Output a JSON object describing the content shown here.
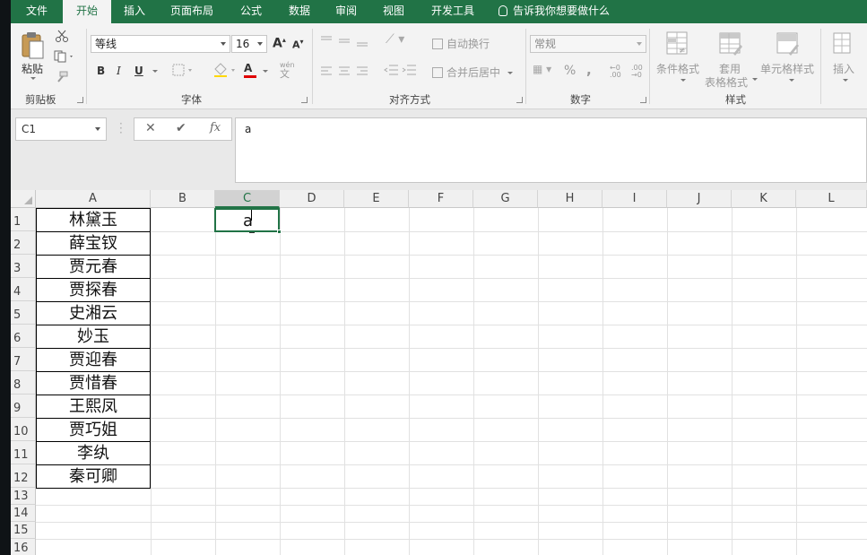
{
  "menu": {
    "tabs": [
      "文件",
      "开始",
      "插入",
      "页面布局",
      "公式",
      "数据",
      "审阅",
      "视图",
      "开发工具"
    ],
    "active_tab": "开始",
    "tell_me": "告诉我你想要做什么"
  },
  "ribbon": {
    "clipboard": {
      "paste": "粘贴",
      "label": "剪贴板"
    },
    "font": {
      "name": "等线",
      "size": "16",
      "bold": "B",
      "italic": "I",
      "underline": "U",
      "label": "字体",
      "grow": "A",
      "shrink": "A",
      "phonetic_top": "wén",
      "phonetic_bottom": "文",
      "font_color": "A"
    },
    "alignment": {
      "wrap": "自动换行",
      "merge": "合并后居中",
      "label": "对齐方式"
    },
    "number": {
      "format": "常规",
      "percent": "%",
      "comma": ",",
      "label": "数字",
      "inc_decimal": "←0 .00",
      "dec_decimal": ".00 →0"
    },
    "styles": {
      "conditional": "条件格式",
      "table_top": "套用",
      "table_bottom": "表格格式",
      "cell_styles": "单元格样式",
      "label": "样式"
    },
    "cells": {
      "insert": "插入"
    }
  },
  "formula_bar": {
    "name_box": "C1",
    "cancel": "✕",
    "enter": "✔",
    "fx": "fx",
    "content": "a"
  },
  "sheet": {
    "columns": [
      "A",
      "B",
      "C",
      "D",
      "E",
      "F",
      "G",
      "H",
      "I",
      "J",
      "K",
      "L"
    ],
    "selected_column": "C",
    "rows": [
      "1",
      "2",
      "3",
      "4",
      "5",
      "6",
      "7",
      "8",
      "9",
      "10",
      "11",
      "12",
      "13",
      "14",
      "15",
      "16"
    ],
    "column_a": [
      "林黛玉",
      "薛宝钗",
      "贾元春",
      "贾探春",
      "史湘云",
      "妙玉",
      "贾迎春",
      "贾惜春",
      "王熙凤",
      "贾巧姐",
      "李纨",
      "秦可卿"
    ],
    "active_cell": "C1",
    "active_cell_value": "a"
  },
  "colors": {
    "accent": "#217346",
    "ribbon_bg": "#f3f3f3",
    "font_color_bar": "#e00000"
  }
}
